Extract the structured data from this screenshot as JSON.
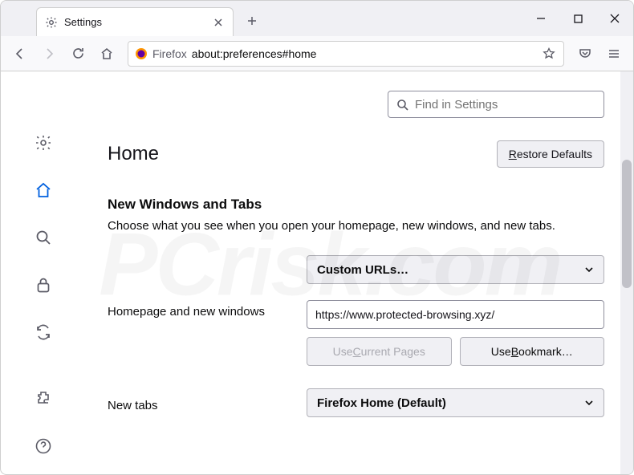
{
  "titlebar": {
    "tab_title": "Settings"
  },
  "toolbar": {
    "brand": "Firefox",
    "url": "about:preferences#home"
  },
  "search": {
    "placeholder": "Find in Settings"
  },
  "header": {
    "title": "Home",
    "restore_button": "Restore Defaults"
  },
  "new_windows": {
    "section_title": "New Windows and Tabs",
    "section_desc": "Choose what you see when you open your homepage, new windows, and new tabs.",
    "homepage_select": "Custom URLs…",
    "homepage_label": "Homepage and new windows",
    "homepage_value": "https://www.protected-browsing.xyz/",
    "use_current_pages": "Use Current Pages",
    "use_bookmark": "Use Bookmark…",
    "newtabs_label": "New tabs",
    "newtabs_select": "Firefox Home (Default)"
  },
  "watermark": "PCrisk.com"
}
